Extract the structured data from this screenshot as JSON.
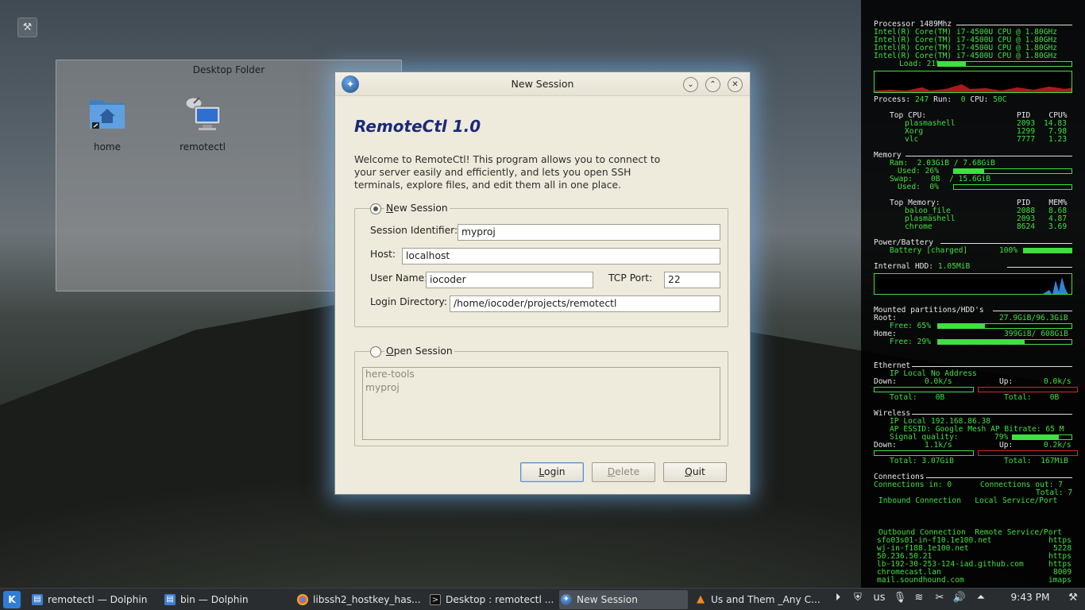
{
  "desktop": {
    "folder_title": "Desktop Folder",
    "icons": [
      {
        "label": "home",
        "icon": "folder-home-icon"
      },
      {
        "label": "remotectl",
        "icon": "network-computer-icon"
      }
    ]
  },
  "dialog": {
    "title": "New Session",
    "app_title": "RemoteCtl 1.0",
    "welcome": "Welcome to RemoteCtl! This program allows you to connect to your server easily and efficiently, and lets you open SSH terminals, explore files, and edit them all in one place.",
    "new_session": {
      "label": "New Session",
      "selected": true,
      "session_id_label": "Session Identifier:",
      "session_id_value": "myproj",
      "host_label": "Host:",
      "host_value": "localhost",
      "user_label": "User Name:",
      "user_value": "iocoder",
      "port_label": "TCP Port:",
      "port_value": "22",
      "dir_label": "Login Directory:",
      "dir_value": "/home/iocoder/projects/remotectl"
    },
    "open_session": {
      "label": "Open Session",
      "selected": false,
      "sessions": [
        "here-tools",
        "myproj"
      ]
    },
    "buttons": {
      "login": "Login",
      "delete": "Delete",
      "quit": "Quit"
    }
  },
  "conky": {
    "processor": "Processor 1489Mhz",
    "cpus": [
      "Intel(R) Core(TM) i7-4500U CPU @ 1.80GHz",
      "Intel(R) Core(TM) i7-4500U CPU @ 1.80GHz",
      "Intel(R) Core(TM) i7-4500U CPU @ 1.80GHz",
      "Intel(R) Core(TM) i7-4500U CPU @ 1.80GHz"
    ],
    "load_label": "Load: 21%",
    "load": 0.21,
    "process_line_a": "Process:",
    "process_line_b": "247",
    "process_line_c": "Run:",
    "process_line_d": "0",
    "process_line_e": "CPU:",
    "process_line_f": "50C",
    "top_cpu_header": "Top CPU:",
    "top_cpu_cols": "PID    CPU%",
    "top_cpu": [
      {
        "name": "plasmashell",
        "pid": "2093",
        "val": "14.83"
      },
      {
        "name": "Xorg",
        "pid": "1299",
        "val": "7.98"
      },
      {
        "name": "vlc",
        "pid": "7777",
        "val": "1.23"
      }
    ],
    "memory_header": "Memory",
    "ram": "Ram:  2.03GiB / 7.68GiB",
    "ram_used": "Used: 26%",
    "ram_pct": 0.26,
    "swap": "Swap:    0B  / 15.6GiB",
    "swap_used": "Used:  0%",
    "swap_pct": 0,
    "top_mem_header": "Top Memory:",
    "top_mem_cols": "PID    MEM%",
    "top_mem": [
      {
        "name": "baloo_file",
        "pid": "2088",
        "val": "8.68"
      },
      {
        "name": "plasmashell",
        "pid": "2093",
        "val": "4.87"
      },
      {
        "name": "chrome",
        "pid": "8624",
        "val": "3.69"
      }
    ],
    "power_header": "Power/Battery",
    "battery": "Battery [charged]",
    "battery_pct_label": "100%",
    "battery_pct": 1.0,
    "hdd_label": "Internal HDD:",
    "hdd_value": "1.05MiB",
    "partitions_header": "Mounted partitions/HDD's",
    "root_label": "Root:",
    "root_value": "27.9GiB/96.3GiB",
    "root_free": "Free: 65%",
    "root_free_pct": 0.35,
    "home_label": "Home:",
    "home_value": "399GiB/ 608GiB",
    "home_free": "Free: 29%",
    "home_free_pct": 0.65,
    "ethernet_header": "Ethernet",
    "eth_ip": "IP Local No Address",
    "eth_down_label": "Down:",
    "eth_down": "0.0k/s",
    "eth_up_label": "Up:",
    "eth_up": "0.0k/s",
    "eth_total_down": "Total:    0B",
    "eth_total_up": "Total:    0B",
    "wireless_header": "Wireless",
    "wl_ip": "IP Local 192.168.86.38",
    "wl_essid": "AP ESSID: Google Mesh AP Bitrate: 65 M",
    "wl_signal_label": "Signal quality:",
    "wl_signal": "79%",
    "wl_signal_pct": 0.79,
    "wl_down_label": "Down:",
    "wl_down": "1.1k/s",
    "wl_up_label": "Up:",
    "wl_up": "0.2k/s",
    "wl_total_down": "Total: 3.07GiB",
    "wl_total_up": "Total:  167MiB",
    "connections_header": "Connections",
    "conn_in": "Connections in: 0",
    "conn_out": "Connections out: 7",
    "conn_total": "Total: 7",
    "inbound_cols": "Inbound Connection   Local Service/Port",
    "outbound_cols": "Outbound Connection  Remote Service/Port",
    "outbound": [
      {
        "host": "sfo03s01-in-f10.1e100.net",
        "port": "https"
      },
      {
        "host": "wj-in-f188.1e100.net",
        "port": "5228"
      },
      {
        "host": "50.236.50.21",
        "port": "https"
      },
      {
        "host": "lb-192-30-253-124-iad.github.com",
        "port": "https"
      },
      {
        "host": "chromecast.lan",
        "port": "8009"
      },
      {
        "host": "mail.soundhound.com",
        "port": "imaps"
      }
    ]
  },
  "taskbar": {
    "tasks": [
      {
        "label": "remotectl — Dolphin",
        "icon": "dolphin-icon"
      },
      {
        "label": "bin — Dolphin",
        "icon": "dolphin-icon"
      },
      {
        "label": "libssh2_hostkey_has...",
        "icon": "chrome-icon"
      },
      {
        "label": "Desktop : remotectl ...",
        "icon": "terminal-icon"
      },
      {
        "label": "New Session",
        "icon": "remotectl-icon"
      },
      {
        "label": "Us and Them _Any C...",
        "icon": "vlc-icon"
      }
    ],
    "keyboard_layout": "us",
    "clock": "9:43 PM"
  }
}
